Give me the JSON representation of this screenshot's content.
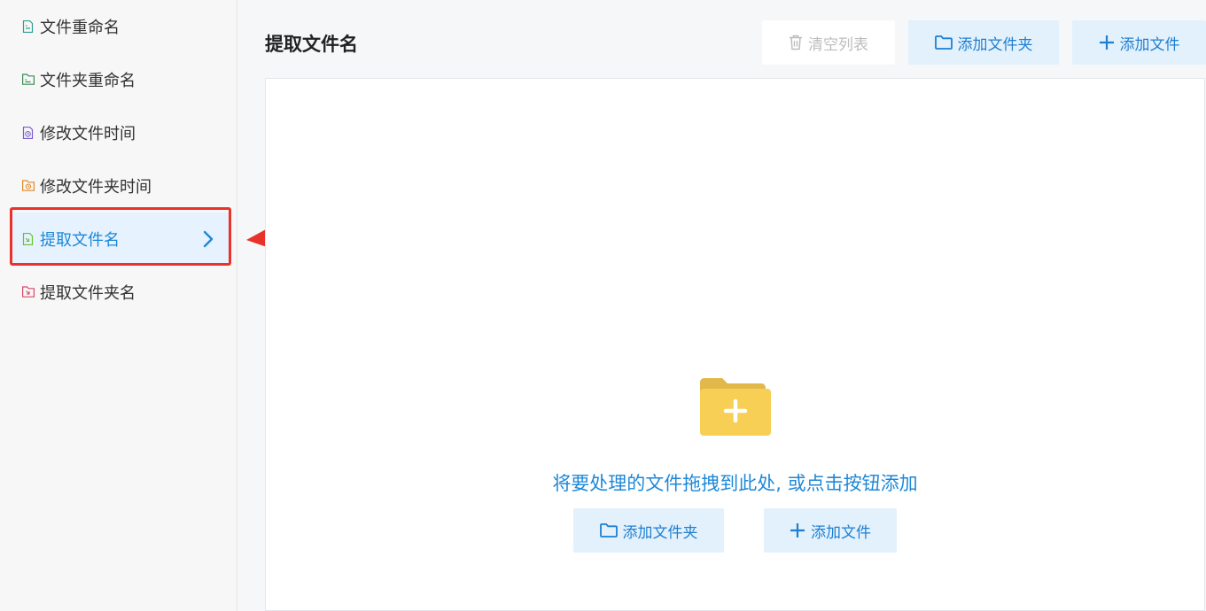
{
  "sidebar": {
    "items": [
      {
        "label": "文件重命名",
        "icon": "file-rename-icon",
        "color": "#2e9e8f"
      },
      {
        "label": "文件夹重命名",
        "icon": "folder-rename-icon",
        "color": "#3d8a55"
      },
      {
        "label": "修改文件时间",
        "icon": "file-time-icon",
        "color": "#7b5ccf"
      },
      {
        "label": "修改文件夹时间",
        "icon": "folder-time-icon",
        "color": "#e08a2a"
      },
      {
        "label": "提取文件名",
        "icon": "extract-filename-icon",
        "color": "#6abf3a",
        "active": true
      },
      {
        "label": "提取文件夹名",
        "icon": "extract-foldername-icon",
        "color": "#d9486a"
      }
    ]
  },
  "header": {
    "title": "提取文件名",
    "clear_label": "清空列表",
    "add_folder_label": "添加文件夹",
    "add_file_label": "添加文件"
  },
  "drop_area": {
    "hint": "将要处理的文件拖拽到此处, 或点击按钮添加",
    "add_folder_label": "添加文件夹",
    "add_file_label": "添加文件"
  },
  "colors": {
    "accent": "#1e88d8",
    "highlight": "#e8322b",
    "folder": "#f7c948"
  }
}
